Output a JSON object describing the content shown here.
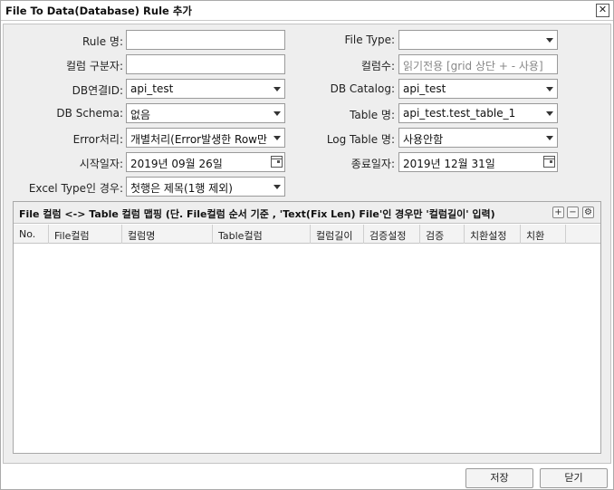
{
  "window": {
    "title": "File To Data(Database) Rule 추가",
    "close_label": "✕"
  },
  "form": {
    "rule_name": {
      "label": "Rule 명:",
      "value": ""
    },
    "column_delimiter": {
      "label": "컬럼 구분자:",
      "value": ""
    },
    "db_connection": {
      "label": "DB연결ID:",
      "value": "api_test"
    },
    "db_schema": {
      "label": "DB Schema:",
      "value": "없음"
    },
    "error_handling": {
      "label": "Error처리:",
      "value": "개별처리(Error발생한 Row만 S"
    },
    "start_date": {
      "label": "시작일자:",
      "value": "2019년 09월 26일"
    },
    "excel_type": {
      "label": "Excel Type인 경우:",
      "value": "첫행은 제목(1행 제외)"
    },
    "file_type": {
      "label": "File Type:",
      "value": ""
    },
    "column_count": {
      "label": "컬럼수:",
      "placeholder": "읽기전용 [grid 상단 + - 사용]"
    },
    "db_catalog": {
      "label": "DB Catalog:",
      "value": "api_test"
    },
    "table_name": {
      "label": "Table 명:",
      "value": "api_test.test_table_1"
    },
    "log_table": {
      "label": "Log Table 명:",
      "value": "사용안함"
    },
    "end_date": {
      "label": "종료일자:",
      "value": "2019년 12월 31일"
    }
  },
  "mapping": {
    "title": "File 컬럼 <-> Table 컬럼 맵핑 (단. File컬럼 순서 기준 , 'Text(Fix Len) File'인 경우만 '컬럼길이' 입력)",
    "buttons": {
      "add": "+",
      "remove": "−",
      "settings": "⚙"
    },
    "columns": [
      "No.",
      "File컬럼",
      "컬럼명",
      "Table컬럼",
      "컬럼길이",
      "검증설정",
      "검증",
      "치환설정",
      "치환"
    ],
    "rows": []
  },
  "footer": {
    "save_label": "저장",
    "close_label": "닫기"
  }
}
